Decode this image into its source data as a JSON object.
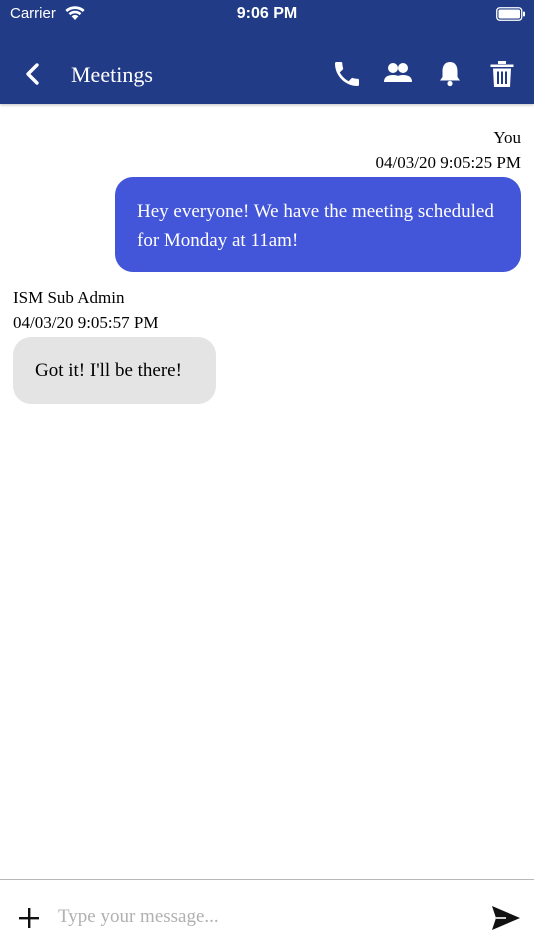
{
  "status_bar": {
    "carrier": "Carrier",
    "time": "9:06 PM",
    "icons": [
      "wifi-icon",
      "battery-icon"
    ]
  },
  "nav": {
    "title": "Meetings",
    "icons": [
      "chevron-left-icon",
      "phone-icon",
      "group-icon",
      "bell-icon",
      "trash-icon"
    ]
  },
  "messages": [
    {
      "sender": "You",
      "timestamp": "04/03/20 9:05:25 PM",
      "text": "Hey everyone! We have the meeting scheduled for Monday at 11am!",
      "direction": "sent"
    },
    {
      "sender": "ISM Sub Admin",
      "timestamp": "04/03/20 9:05:57 PM",
      "text": "Got it! I'll be there!",
      "direction": "received"
    }
  ],
  "composer": {
    "placeholder": "Type your message...",
    "value": "",
    "icons": [
      "plus-icon",
      "send-icon"
    ]
  },
  "colors": {
    "header": "#213b86",
    "sent_bubble": "#4356d9",
    "received_bubble": "#e4e4e4"
  }
}
